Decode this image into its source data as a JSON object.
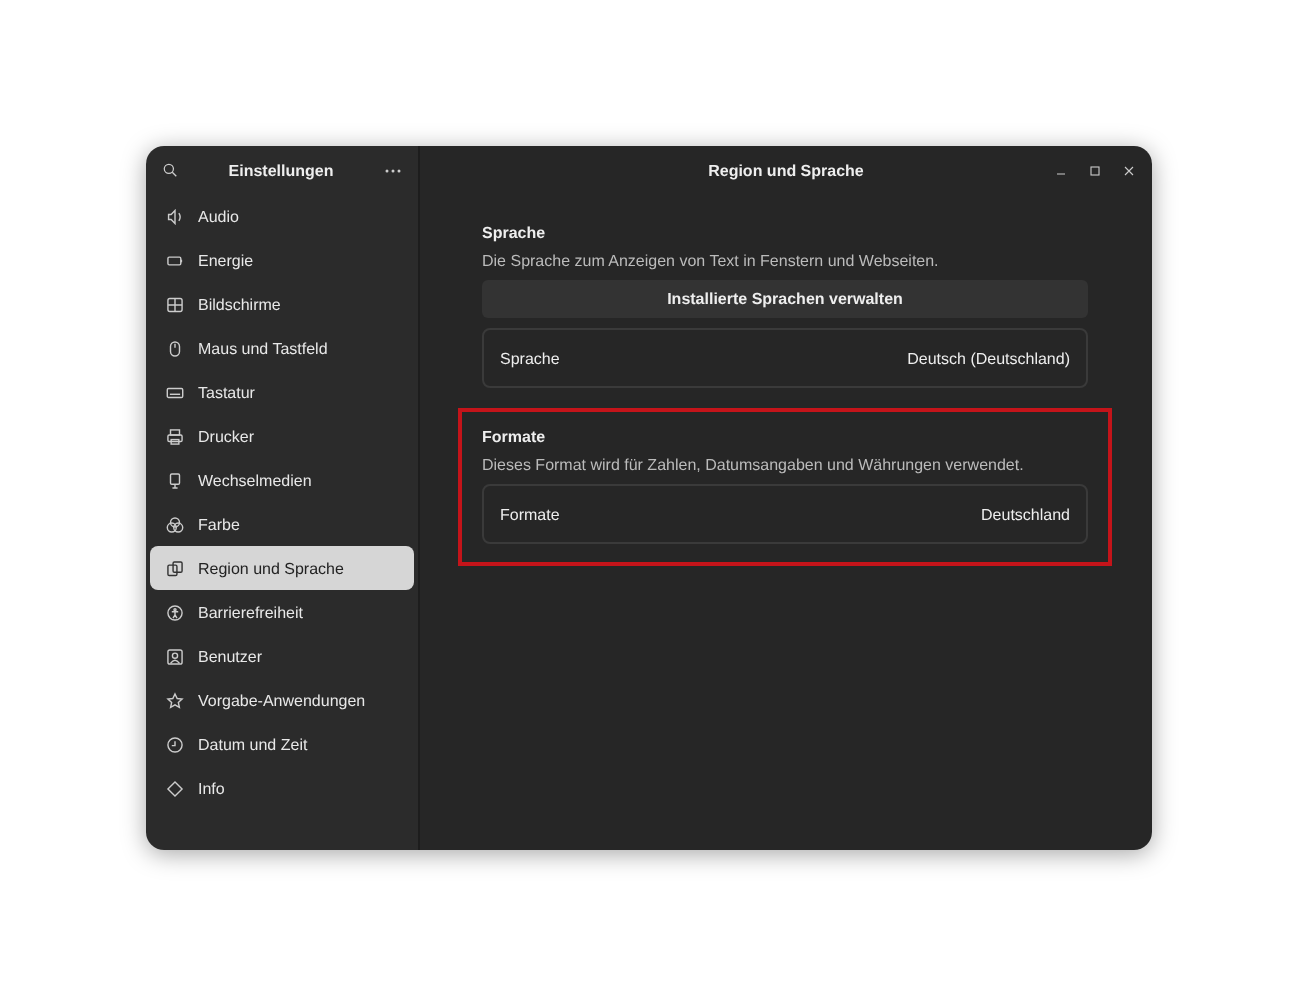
{
  "sidebar": {
    "title": "Einstellungen",
    "items": [
      {
        "label": "Audio",
        "selected": false
      },
      {
        "label": "Energie",
        "selected": false
      },
      {
        "label": "Bildschirme",
        "selected": false
      },
      {
        "label": "Maus und Tastfeld",
        "selected": false
      },
      {
        "label": "Tastatur",
        "selected": false
      },
      {
        "label": "Drucker",
        "selected": false
      },
      {
        "label": "Wechselmedien",
        "selected": false
      },
      {
        "label": "Farbe",
        "selected": false
      },
      {
        "label": "Region und Sprache",
        "selected": true
      },
      {
        "label": "Barrierefreiheit",
        "selected": false
      },
      {
        "label": "Benutzer",
        "selected": false
      },
      {
        "label": "Vorgabe-Anwendungen",
        "selected": false
      },
      {
        "label": "Datum und Zeit",
        "selected": false
      },
      {
        "label": "Info",
        "selected": false
      }
    ]
  },
  "window": {
    "title": "Region und Sprache"
  },
  "sections": [
    {
      "title": "Sprache",
      "description": "Die Sprache zum Anzeigen von Text in Fenstern und Webseiten.",
      "highlighted": false,
      "button": "Installierte Sprachen verwalten",
      "row": {
        "label": "Sprache",
        "value": "Deutsch (Deutschland)"
      }
    },
    {
      "title": "Formate",
      "description": "Dieses Format wird für Zahlen, Datumsangaben und Währungen verwendet.",
      "highlighted": true,
      "row": {
        "label": "Formate",
        "value": "Deutschland"
      }
    }
  ]
}
